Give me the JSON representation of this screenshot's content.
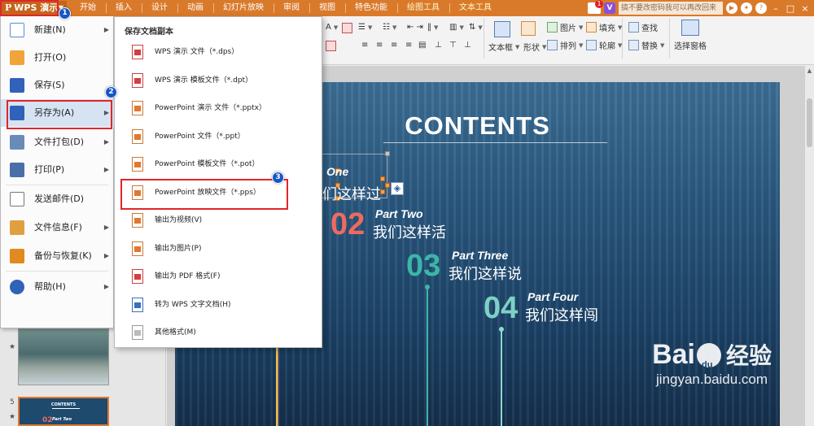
{
  "app": {
    "name": "WPS 演示",
    "logo_glyph": "P"
  },
  "menu_tabs": [
    "开始",
    "插入",
    "设计",
    "动画",
    "幻灯片放映",
    "审阅",
    "视图",
    "特色功能",
    "绘图工具",
    "文本工具"
  ],
  "top_right": {
    "notification_count": "1",
    "vip_label": "V",
    "search_placeholder": "搞不要改密码我可以再改回来"
  },
  "ribbon": {
    "textbox": "文本框",
    "shape": "形状",
    "picture": "图片",
    "arrange": "排列",
    "fill": "填充",
    "outline": "轮廓",
    "find": "查找",
    "replace": "替换",
    "selection_pane": "选择窗格"
  },
  "file_menu": {
    "items": [
      {
        "label": "新建(N)",
        "has_arrow": true
      },
      {
        "label": "打开(O)",
        "has_arrow": false
      },
      {
        "label": "保存(S)",
        "has_arrow": false
      },
      {
        "label": "另存为(A)",
        "has_arrow": true
      },
      {
        "label": "文件打包(D)",
        "has_arrow": true
      },
      {
        "label": "打印(P)",
        "has_arrow": true
      },
      {
        "label": "发送邮件(D)",
        "has_arrow": false
      },
      {
        "label": "文件信息(F)",
        "has_arrow": true
      },
      {
        "label": "备份与恢复(K)",
        "has_arrow": true
      },
      {
        "label": "帮助(H)",
        "has_arrow": true
      }
    ]
  },
  "save_as_submenu": {
    "header": "保存文档副本",
    "items": [
      "WPS 演示 文件（*.dps）",
      "WPS 演示 模板文件（*.dpt）",
      "PowerPoint 演示 文件（*.pptx）",
      "PowerPoint 文件（*.ppt）",
      "PowerPoint 模板文件（*.pot）",
      "PowerPoint 放映文件（*.pps）",
      "输出为视频(V)",
      "输出为图片(P)",
      "输出为 PDF 格式(F)",
      "转为 WPS 文字文档(H)",
      "其他格式(M)"
    ]
  },
  "markers": [
    "1",
    "2",
    "3"
  ],
  "thumbnails": {
    "slide5_number": "5",
    "slide5_title": "CONTENTS",
    "slide5_num": "02",
    "slide5_part": "Part Two"
  },
  "slide": {
    "title": "CONTENTS",
    "items": [
      {
        "num": "",
        "part": "One",
        "zh": "们这样过"
      },
      {
        "num": "02",
        "part": "Part Two",
        "zh": "我们这样活"
      },
      {
        "num": "03",
        "part": "Part Three",
        "zh": "我们这样说"
      },
      {
        "num": "04",
        "part": "Part Four",
        "zh": "我们这样闯"
      }
    ],
    "colors": {
      "accent_02": "#ef6b5f",
      "accent_03": "#3bb6a8",
      "accent_04": "#7fd0c6",
      "line_02": "#e07a6a",
      "line_03": "#3bb6a8",
      "line_04": "#8fd8cf"
    }
  },
  "watermark": {
    "brand": "Bai",
    "brand_cn": "经验",
    "url": "jingyan.baidu.com"
  }
}
